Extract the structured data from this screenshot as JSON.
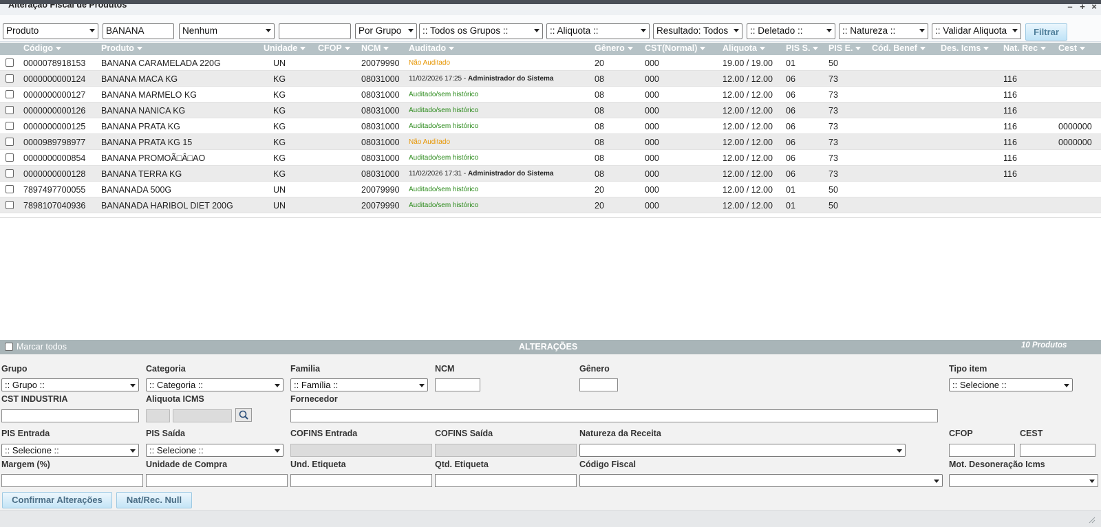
{
  "window": {
    "title": "Alteração Fiscal de Produtos",
    "controls": {
      "minimize": "–",
      "maximize": "+",
      "close": "×"
    }
  },
  "filters": {
    "search_by": "Produto",
    "search_text": "BANANA",
    "option": "Nenhum",
    "extra_text": "",
    "group_mode": "Por Grupo",
    "group": ":: Todos os Grupos ::",
    "aliquota": ":: Aliquota ::",
    "resultado": "Resultado: Todos",
    "deletado": ":: Deletado ::",
    "natureza": ":: Natureza ::",
    "validar": ":: Validar Aliquota",
    "filter_button": "Filtrar"
  },
  "columns": [
    "Código",
    "Produto",
    "Unidade",
    "CFOP",
    "NCM",
    "Auditado",
    "Gênero",
    "CST(Normal)",
    "Aliquota",
    "PIS S.",
    "PIS E.",
    "Cód. Benef",
    "Des. Icms",
    "Nat. Rec",
    "Cest"
  ],
  "rows": [
    {
      "codigo": "0000078918153",
      "produto": "BANANA CARAMELADA 220G",
      "unidade": "UN",
      "cfop": "",
      "ncm": "20079990",
      "auditado": "Não Auditado",
      "aud_status": "orange",
      "aud_date": "",
      "aud_user": "",
      "genero": "20",
      "cst": "000",
      "aliquota": "19.00 / 19.00",
      "pis_s": "01",
      "pis_e": "50",
      "cod_benef": "",
      "des_icms": "",
      "nat_rec": "",
      "cest": ""
    },
    {
      "codigo": "0000000000124",
      "produto": "BANANA MACA KG",
      "unidade": "KG",
      "cfop": "",
      "ncm": "08031000",
      "auditado": "",
      "aud_status": "history",
      "aud_date": "11/02/2026 17:25 - ",
      "aud_user": "Administrador do Sistema",
      "genero": "08",
      "cst": "000",
      "aliquota": "12.00 / 12.00",
      "pis_s": "06",
      "pis_e": "73",
      "cod_benef": "",
      "des_icms": "",
      "nat_rec": "116",
      "cest": ""
    },
    {
      "codigo": "0000000000127",
      "produto": "BANANA MARMELO KG",
      "unidade": "KG",
      "cfop": "",
      "ncm": "08031000",
      "auditado": "Auditado/sem histórico",
      "aud_status": "green",
      "aud_date": "",
      "aud_user": "",
      "genero": "08",
      "cst": "000",
      "aliquota": "12.00 / 12.00",
      "pis_s": "06",
      "pis_e": "73",
      "cod_benef": "",
      "des_icms": "",
      "nat_rec": "116",
      "cest": ""
    },
    {
      "codigo": "0000000000126",
      "produto": "BANANA NANICA KG",
      "unidade": "KG",
      "cfop": "",
      "ncm": "08031000",
      "auditado": "Auditado/sem histórico",
      "aud_status": "green",
      "aud_date": "",
      "aud_user": "",
      "genero": "08",
      "cst": "000",
      "aliquota": "12.00 / 12.00",
      "pis_s": "06",
      "pis_e": "73",
      "cod_benef": "",
      "des_icms": "",
      "nat_rec": "116",
      "cest": ""
    },
    {
      "codigo": "0000000000125",
      "produto": "BANANA PRATA KG",
      "unidade": "KG",
      "cfop": "",
      "ncm": "08031000",
      "auditado": "Auditado/sem histórico",
      "aud_status": "green",
      "aud_date": "",
      "aud_user": "",
      "genero": "08",
      "cst": "000",
      "aliquota": "12.00 / 12.00",
      "pis_s": "06",
      "pis_e": "73",
      "cod_benef": "",
      "des_icms": "",
      "nat_rec": "116",
      "cest": "0000000"
    },
    {
      "codigo": "0000989798977",
      "produto": "BANANA PRATA KG 15",
      "unidade": "KG",
      "cfop": "",
      "ncm": "08031000",
      "auditado": "Não Auditado",
      "aud_status": "orange",
      "aud_date": "",
      "aud_user": "",
      "genero": "08",
      "cst": "000",
      "aliquota": "12.00 / 12.00",
      "pis_s": "06",
      "pis_e": "73",
      "cod_benef": "",
      "des_icms": "",
      "nat_rec": "116",
      "cest": "0000000"
    },
    {
      "codigo": "0000000000854",
      "produto": "BANANA PROMOÃ□Â□AO",
      "unidade": "KG",
      "cfop": "",
      "ncm": "08031000",
      "auditado": "Auditado/sem histórico",
      "aud_status": "green",
      "aud_date": "",
      "aud_user": "",
      "genero": "08",
      "cst": "000",
      "aliquota": "12.00 / 12.00",
      "pis_s": "06",
      "pis_e": "73",
      "cod_benef": "",
      "des_icms": "",
      "nat_rec": "116",
      "cest": ""
    },
    {
      "codigo": "0000000000128",
      "produto": "BANANA TERRA KG",
      "unidade": "KG",
      "cfop": "",
      "ncm": "08031000",
      "auditado": "",
      "aud_status": "history",
      "aud_date": "11/02/2026 17:31 - ",
      "aud_user": "Administrador do Sistema",
      "genero": "08",
      "cst": "000",
      "aliquota": "12.00 / 12.00",
      "pis_s": "06",
      "pis_e": "73",
      "cod_benef": "",
      "des_icms": "",
      "nat_rec": "116",
      "cest": ""
    },
    {
      "codigo": "7897497700055",
      "produto": "BANANADA 500G",
      "unidade": "UN",
      "cfop": "",
      "ncm": "20079990",
      "auditado": "Auditado/sem histórico",
      "aud_status": "green",
      "aud_date": "",
      "aud_user": "",
      "genero": "20",
      "cst": "000",
      "aliquota": "12.00 / 12.00",
      "pis_s": "01",
      "pis_e": "50",
      "cod_benef": "",
      "des_icms": "",
      "nat_rec": "",
      "cest": ""
    },
    {
      "codigo": "7898107040936",
      "produto": "BANANADA HARIBOL DIET 200G",
      "unidade": "UN",
      "cfop": "",
      "ncm": "20079990",
      "auditado": "Auditado/sem histórico",
      "aud_status": "green",
      "aud_date": "",
      "aud_user": "",
      "genero": "20",
      "cst": "000",
      "aliquota": "12.00 / 12.00",
      "pis_s": "01",
      "pis_e": "50",
      "cod_benef": "",
      "des_icms": "",
      "nat_rec": "",
      "cest": ""
    }
  ],
  "alteracoes": {
    "select_all_label": "Marcar todos",
    "title": "ALTERAÇÕES",
    "count": "10 Produtos"
  },
  "form": {
    "labels": {
      "grupo": "Grupo",
      "categoria": "Categoria",
      "familia": "Familia",
      "ncm": "NCM",
      "genero": "Gênero",
      "tipo_item": "Tipo item",
      "cst_industria": "CST INDUSTRIA",
      "aliquota_icms": "Aliquota ICMS",
      "fornecedor": "Fornecedor",
      "pis_entrada": "PIS Entrada",
      "pis_saida": "PIS Saída",
      "cofins_entrada": "COFINS Entrada",
      "cofins_saida": "COFINS Saída",
      "natureza_receita": "Natureza da Receita",
      "cfop": "CFOP",
      "cest": "CEST",
      "margem": "Margem (%)",
      "unidade_compra": "Unidade de Compra",
      "und_etiqueta": "Und. Etiqueta",
      "qtd_etiqueta": "Qtd. Etiqueta",
      "codigo_fiscal": "Código Fiscal",
      "mot_desoneracao": "Mot. Desoneração Icms"
    },
    "selects": {
      "grupo": ":: Grupo ::",
      "categoria": ":: Categoria ::",
      "familia": ":: Família ::",
      "tipo_item": ":: Selecione ::",
      "pis_entrada": ":: Selecione ::",
      "pis_saida": ":: Selecione ::",
      "natureza_receita": "",
      "codigo_fiscal": "",
      "mot_desoneracao": ""
    },
    "buttons": {
      "confirmar": "Confirmar Alterações",
      "natrec_null": "Nat/Rec. Null"
    }
  },
  "colors": {
    "header_bg": "#b6c2c6",
    "alt_row": "#ebebeb",
    "not_audited": "#e69500",
    "audited": "#2a8a1a",
    "button_bg": "#c3e4f6"
  },
  "icons": [
    "minimize-icon",
    "maximize-icon",
    "close-icon",
    "sort-down-icon",
    "search-icon",
    "resize-grip-icon"
  ]
}
